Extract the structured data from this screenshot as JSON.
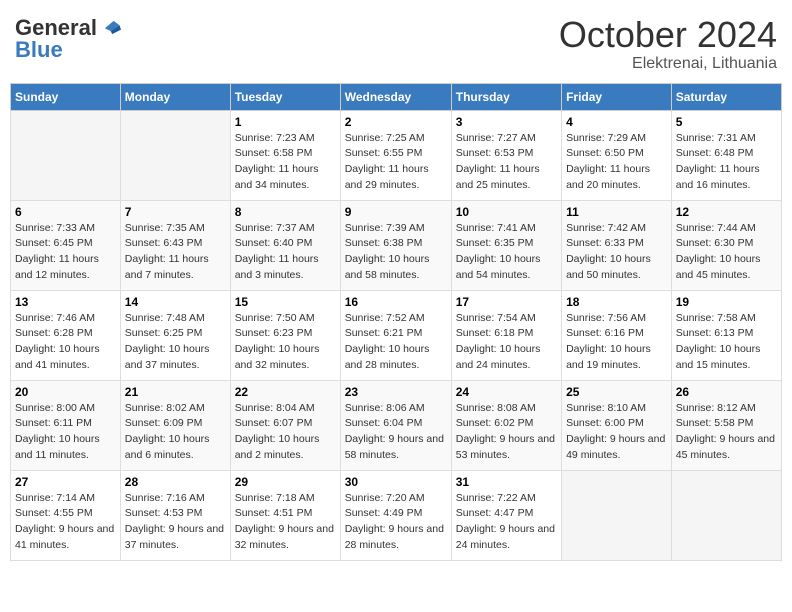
{
  "header": {
    "logo_general": "General",
    "logo_blue": "Blue",
    "month": "October 2024",
    "location": "Elektrenai, Lithuania"
  },
  "days_of_week": [
    "Sunday",
    "Monday",
    "Tuesday",
    "Wednesday",
    "Thursday",
    "Friday",
    "Saturday"
  ],
  "weeks": [
    [
      {
        "day": "",
        "sunrise": "",
        "sunset": "",
        "daylight": ""
      },
      {
        "day": "",
        "sunrise": "",
        "sunset": "",
        "daylight": ""
      },
      {
        "day": "1",
        "sunrise": "Sunrise: 7:23 AM",
        "sunset": "Sunset: 6:58 PM",
        "daylight": "Daylight: 11 hours and 34 minutes."
      },
      {
        "day": "2",
        "sunrise": "Sunrise: 7:25 AM",
        "sunset": "Sunset: 6:55 PM",
        "daylight": "Daylight: 11 hours and 29 minutes."
      },
      {
        "day": "3",
        "sunrise": "Sunrise: 7:27 AM",
        "sunset": "Sunset: 6:53 PM",
        "daylight": "Daylight: 11 hours and 25 minutes."
      },
      {
        "day": "4",
        "sunrise": "Sunrise: 7:29 AM",
        "sunset": "Sunset: 6:50 PM",
        "daylight": "Daylight: 11 hours and 20 minutes."
      },
      {
        "day": "5",
        "sunrise": "Sunrise: 7:31 AM",
        "sunset": "Sunset: 6:48 PM",
        "daylight": "Daylight: 11 hours and 16 minutes."
      }
    ],
    [
      {
        "day": "6",
        "sunrise": "Sunrise: 7:33 AM",
        "sunset": "Sunset: 6:45 PM",
        "daylight": "Daylight: 11 hours and 12 minutes."
      },
      {
        "day": "7",
        "sunrise": "Sunrise: 7:35 AM",
        "sunset": "Sunset: 6:43 PM",
        "daylight": "Daylight: 11 hours and 7 minutes."
      },
      {
        "day": "8",
        "sunrise": "Sunrise: 7:37 AM",
        "sunset": "Sunset: 6:40 PM",
        "daylight": "Daylight: 11 hours and 3 minutes."
      },
      {
        "day": "9",
        "sunrise": "Sunrise: 7:39 AM",
        "sunset": "Sunset: 6:38 PM",
        "daylight": "Daylight: 10 hours and 58 minutes."
      },
      {
        "day": "10",
        "sunrise": "Sunrise: 7:41 AM",
        "sunset": "Sunset: 6:35 PM",
        "daylight": "Daylight: 10 hours and 54 minutes."
      },
      {
        "day": "11",
        "sunrise": "Sunrise: 7:42 AM",
        "sunset": "Sunset: 6:33 PM",
        "daylight": "Daylight: 10 hours and 50 minutes."
      },
      {
        "day": "12",
        "sunrise": "Sunrise: 7:44 AM",
        "sunset": "Sunset: 6:30 PM",
        "daylight": "Daylight: 10 hours and 45 minutes."
      }
    ],
    [
      {
        "day": "13",
        "sunrise": "Sunrise: 7:46 AM",
        "sunset": "Sunset: 6:28 PM",
        "daylight": "Daylight: 10 hours and 41 minutes."
      },
      {
        "day": "14",
        "sunrise": "Sunrise: 7:48 AM",
        "sunset": "Sunset: 6:25 PM",
        "daylight": "Daylight: 10 hours and 37 minutes."
      },
      {
        "day": "15",
        "sunrise": "Sunrise: 7:50 AM",
        "sunset": "Sunset: 6:23 PM",
        "daylight": "Daylight: 10 hours and 32 minutes."
      },
      {
        "day": "16",
        "sunrise": "Sunrise: 7:52 AM",
        "sunset": "Sunset: 6:21 PM",
        "daylight": "Daylight: 10 hours and 28 minutes."
      },
      {
        "day": "17",
        "sunrise": "Sunrise: 7:54 AM",
        "sunset": "Sunset: 6:18 PM",
        "daylight": "Daylight: 10 hours and 24 minutes."
      },
      {
        "day": "18",
        "sunrise": "Sunrise: 7:56 AM",
        "sunset": "Sunset: 6:16 PM",
        "daylight": "Daylight: 10 hours and 19 minutes."
      },
      {
        "day": "19",
        "sunrise": "Sunrise: 7:58 AM",
        "sunset": "Sunset: 6:13 PM",
        "daylight": "Daylight: 10 hours and 15 minutes."
      }
    ],
    [
      {
        "day": "20",
        "sunrise": "Sunrise: 8:00 AM",
        "sunset": "Sunset: 6:11 PM",
        "daylight": "Daylight: 10 hours and 11 minutes."
      },
      {
        "day": "21",
        "sunrise": "Sunrise: 8:02 AM",
        "sunset": "Sunset: 6:09 PM",
        "daylight": "Daylight: 10 hours and 6 minutes."
      },
      {
        "day": "22",
        "sunrise": "Sunrise: 8:04 AM",
        "sunset": "Sunset: 6:07 PM",
        "daylight": "Daylight: 10 hours and 2 minutes."
      },
      {
        "day": "23",
        "sunrise": "Sunrise: 8:06 AM",
        "sunset": "Sunset: 6:04 PM",
        "daylight": "Daylight: 9 hours and 58 minutes."
      },
      {
        "day": "24",
        "sunrise": "Sunrise: 8:08 AM",
        "sunset": "Sunset: 6:02 PM",
        "daylight": "Daylight: 9 hours and 53 minutes."
      },
      {
        "day": "25",
        "sunrise": "Sunrise: 8:10 AM",
        "sunset": "Sunset: 6:00 PM",
        "daylight": "Daylight: 9 hours and 49 minutes."
      },
      {
        "day": "26",
        "sunrise": "Sunrise: 8:12 AM",
        "sunset": "Sunset: 5:58 PM",
        "daylight": "Daylight: 9 hours and 45 minutes."
      }
    ],
    [
      {
        "day": "27",
        "sunrise": "Sunrise: 7:14 AM",
        "sunset": "Sunset: 4:55 PM",
        "daylight": "Daylight: 9 hours and 41 minutes."
      },
      {
        "day": "28",
        "sunrise": "Sunrise: 7:16 AM",
        "sunset": "Sunset: 4:53 PM",
        "daylight": "Daylight: 9 hours and 37 minutes."
      },
      {
        "day": "29",
        "sunrise": "Sunrise: 7:18 AM",
        "sunset": "Sunset: 4:51 PM",
        "daylight": "Daylight: 9 hours and 32 minutes."
      },
      {
        "day": "30",
        "sunrise": "Sunrise: 7:20 AM",
        "sunset": "Sunset: 4:49 PM",
        "daylight": "Daylight: 9 hours and 28 minutes."
      },
      {
        "day": "31",
        "sunrise": "Sunrise: 7:22 AM",
        "sunset": "Sunset: 4:47 PM",
        "daylight": "Daylight: 9 hours and 24 minutes."
      },
      {
        "day": "",
        "sunrise": "",
        "sunset": "",
        "daylight": ""
      },
      {
        "day": "",
        "sunrise": "",
        "sunset": "",
        "daylight": ""
      }
    ]
  ]
}
